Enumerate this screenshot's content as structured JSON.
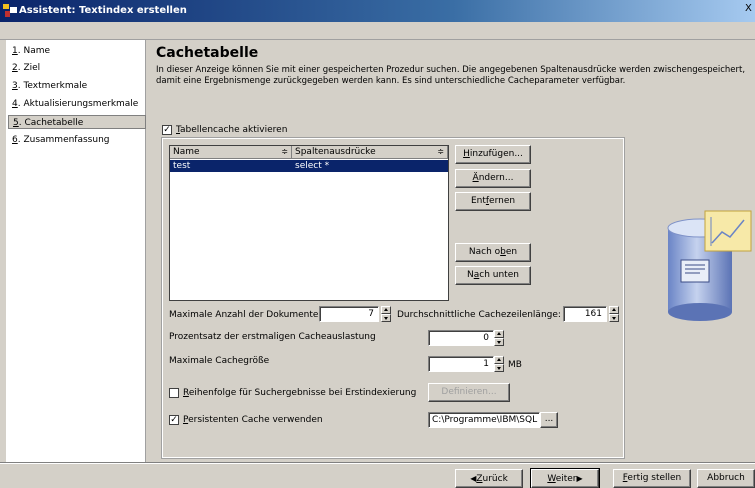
{
  "window": {
    "title": "Assistent: Textindex erstellen",
    "close_label": "X"
  },
  "sidebar": {
    "items": [
      {
        "key": "1",
        "rest": ". Name"
      },
      {
        "key": "2",
        "rest": ". Ziel"
      },
      {
        "key": "3",
        "rest": ". Textmerkmale"
      },
      {
        "key": "4",
        "rest": ". Aktualisierungsmerkmale"
      },
      {
        "key": "5",
        "rest": ". Cachetabelle"
      },
      {
        "key": "6",
        "rest": ". Zusammenfassung"
      }
    ]
  },
  "main": {
    "title": "Cachetabelle",
    "description": "In dieser Anzeige können Sie mit einer gespeicherten Prozedur suchen. Die angegebenen Spaltenausdrücke werden zwischengespeichert, damit eine Ergebnismenge zurückgegeben werden kann. Es sind unterschiedliche Cacheparameter verfügbar.",
    "enable_cache": {
      "checked": "✓",
      "key": "T",
      "rest": "abellencache aktivieren"
    },
    "table": {
      "headers": [
        "Name",
        "Spaltenausdrücke"
      ],
      "rows": [
        {
          "name": "test",
          "expr": "select *"
        }
      ]
    },
    "buttons": {
      "add": {
        "key": "H",
        "rest": "inzufügen..."
      },
      "change_pre": "Ä",
      "change_rest": "ndern...",
      "remove_pre": "Ent",
      "remove_key": "f",
      "remove_rest": "ernen",
      "up_pre": "Nach o",
      "up_key": "b",
      "up_rest": "en",
      "down_pre": "N",
      "down_key": "a",
      "down_rest": "ch unten"
    },
    "max_docs": {
      "label": "Maximale Anzahl der Dokumente:",
      "value": "7"
    },
    "avg_row": {
      "label": "Durchschnittliche Cachezeilenlänge:",
      "value": "161"
    },
    "initial_pct": {
      "label": "Prozentsatz der erstmaligen Cacheauslastung",
      "value": "0"
    },
    "max_size": {
      "label": "Maximale Cachegröße",
      "value": "1",
      "unit": "MB"
    },
    "order": {
      "checked": "",
      "key": "R",
      "rest": "eihenfolge für Suchergebnisse bei Erstindexierung",
      "button": "Definieren..."
    },
    "persistent": {
      "checked": "✓",
      "key": "P",
      "rest": "ersistenten Cache verwenden",
      "path": "C:\\Programme\\IBM\\SQL",
      "browse": "..."
    }
  },
  "footer": {
    "back": {
      "arrow": "◀",
      "key": "Z",
      "rest": "urück"
    },
    "next": {
      "key": "W",
      "rest": "eiter",
      "arrow": "▶"
    },
    "finish": {
      "key": "F",
      "rest": "ertig stellen"
    },
    "cancel": "Abbruch"
  },
  "colors": {
    "selection": "#0a246a",
    "titlebar": "#0a246a",
    "face": "#d4d0c8"
  }
}
